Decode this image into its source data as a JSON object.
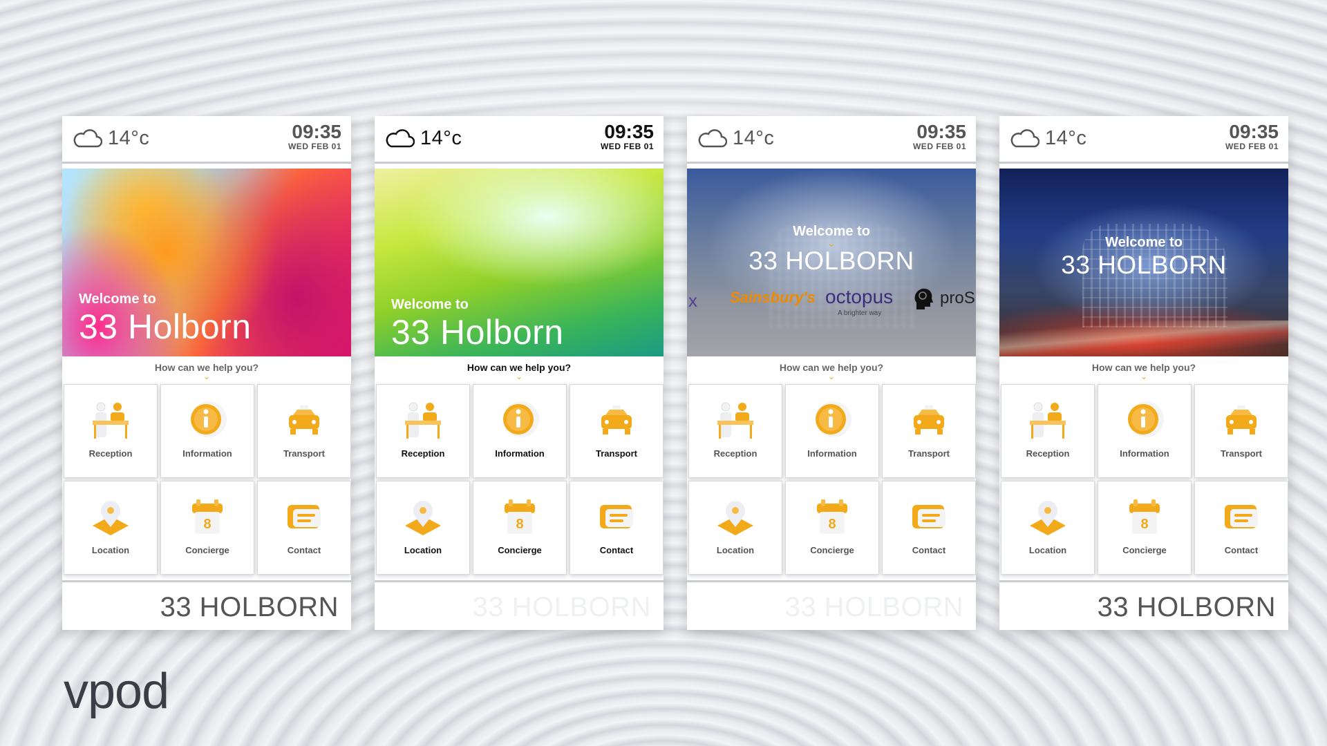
{
  "brand_logo": "vpod",
  "screens": [
    {
      "weather_icon": "cloud-icon",
      "temp": "14°c",
      "time": "09:35",
      "date": "WED FEB 01",
      "welcome": "Welcome to",
      "title": "33 Holborn",
      "help": "How can we help you?",
      "footer": "33 HOLBORN"
    },
    {
      "weather_icon": "cloud-icon",
      "temp": "14°c",
      "time": "09:35",
      "date": "WED FEB 01",
      "welcome": "Welcome to",
      "title": "33 Holborn",
      "help": "How can we help you?",
      "footer": "33 HOLBORN"
    },
    {
      "weather_icon": "cloud-icon",
      "temp": "14°c",
      "time": "09:35",
      "date": "WED FEB 01",
      "welcome": "Welcome to",
      "title": "33 HOLBORN",
      "help": "How can we help you?",
      "footer": "33 HOLBORN",
      "logos": {
        "x": "x",
        "sainsburys": "Sainsbury's",
        "octopus": "octopus",
        "octopus_tagline": "A brighter way",
        "pros": "proS"
      }
    },
    {
      "weather_icon": "cloud-icon",
      "temp": "14°c",
      "time": "09:35",
      "date": "WED FEB 01",
      "welcome": "Welcome to",
      "title": "33 HOLBORN",
      "help": "How can we help you?",
      "footer": "33 HOLBORN"
    }
  ],
  "menu": [
    {
      "label": "Reception",
      "icon": "reception-desk-icon"
    },
    {
      "label": "Information",
      "icon": "info-icon"
    },
    {
      "label": "Transport",
      "icon": "taxi-icon"
    },
    {
      "label": "Location",
      "icon": "location-pin-icon"
    },
    {
      "label": "Concierge",
      "icon": "calendar-icon"
    },
    {
      "label": "Contact",
      "icon": "chat-bubble-icon"
    }
  ],
  "colors": {
    "accent": "#f2a91a",
    "text": "#555555"
  }
}
